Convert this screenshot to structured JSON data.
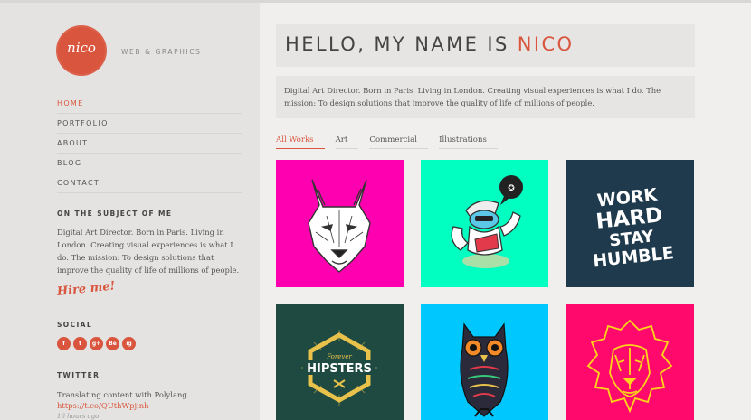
{
  "site": {
    "logo_text": "nico",
    "tagline": "WEB & GRAPHICS"
  },
  "nav": [
    {
      "label": "HOME",
      "active": true
    },
    {
      "label": "PORTFOLIO",
      "active": false
    },
    {
      "label": "ABOUT",
      "active": false
    },
    {
      "label": "BLOG",
      "active": false
    },
    {
      "label": "CONTACT",
      "active": false
    }
  ],
  "about": {
    "title": "ON THE SUBJECT OF ME",
    "text": "Digital Art Director. Born in Paris. Living in London. Creating visual experiences is what I do. The mission: To design solutions that improve the quality of life of millions of people.",
    "hire_label": "Hire me!"
  },
  "social": {
    "title": "SOCIAL",
    "icons": [
      "f",
      "t",
      "g+",
      "Bē",
      "ig"
    ],
    "icon_names": [
      "facebook-icon",
      "twitter-icon",
      "google-plus-icon",
      "behance-icon",
      "instagram-icon"
    ]
  },
  "twitter": {
    "title": "TWITTER",
    "tweet": "Translating content with Polylang",
    "link": "https://t.co/QUthWpjinh",
    "time": "16 hours ago"
  },
  "main": {
    "headline_prefix": "HELLO, MY NAME IS ",
    "headline_accent": "NICO",
    "intro": "Digital Art Director. Born in Paris. Living in London. Creating visual experiences is what I do. The mission: To design solutions that improve the quality of life of millions of people."
  },
  "filters": [
    {
      "label": "All Works",
      "active": true
    },
    {
      "label": "Art",
      "active": false
    },
    {
      "label": "Commercial",
      "active": false
    },
    {
      "label": "Illustrations",
      "active": false
    }
  ],
  "portfolio": {
    "tiles": [
      {
        "name": "wolf",
        "bg": "#ff00b0"
      },
      {
        "name": "character",
        "bg": "#00ffc0"
      },
      {
        "name": "work-hard",
        "bg": "#1f3a4d",
        "lines": [
          "WORK",
          "HARD",
          "STAY",
          "HUMBLE"
        ]
      },
      {
        "name": "hipsters",
        "bg": "#1f4a42",
        "small": "Forever",
        "big": "HIPSTERS"
      },
      {
        "name": "owl",
        "bg": "#00c8ff"
      },
      {
        "name": "lion",
        "bg": "#ff0a6c"
      }
    ]
  },
  "colors": {
    "accent": "#d9553d",
    "sidebar_bg": "#e4e3e1",
    "page_bg": "#f0efee"
  }
}
